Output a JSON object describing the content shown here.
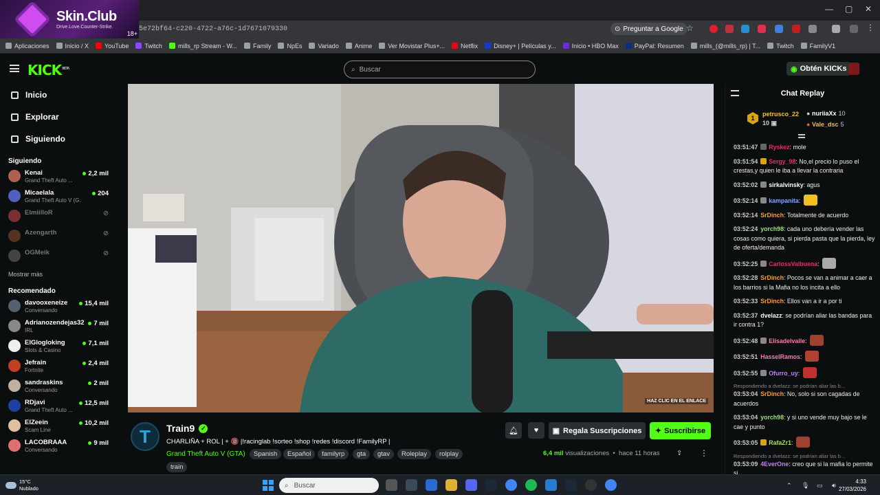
{
  "browser": {
    "url": "5e72bf64-c220-4722-a76c-1d7671079330",
    "ask_google": "Preguntar a Google",
    "ad_brand": "Skin.Club",
    "ad_slogan": "Drive.Love.Counter-Strike.",
    "ad_age": "18+",
    "bookmarks": [
      {
        "label": "Aplicaciones",
        "color": "#9aa0a6"
      },
      {
        "label": "Inicio / X",
        "color": "#9aa0a6"
      },
      {
        "label": "YouTube",
        "color": "#ff0000"
      },
      {
        "label": "Twitch",
        "color": "#9146ff"
      },
      {
        "label": "mills_rp Stream - W...",
        "color": "#53fc18"
      },
      {
        "label": "Family",
        "color": "#9aa0a6"
      },
      {
        "label": "NpEs",
        "color": "#9aa0a6"
      },
      {
        "label": "Variado",
        "color": "#9aa0a6"
      },
      {
        "label": "Anime",
        "color": "#9aa0a6"
      },
      {
        "label": "Ver Movistar Plus+...",
        "color": "#9aa0a6"
      },
      {
        "label": "Netflix",
        "color": "#e50914"
      },
      {
        "label": "Disney+ | Películas y...",
        "color": "#113ccf"
      },
      {
        "label": "Inicio • HBO Max",
        "color": "#6b2bd6"
      },
      {
        "label": "PayPal: Resumen",
        "color": "#003087"
      },
      {
        "label": "mills_(@mills_rp) | T...",
        "color": "#9aa0a6"
      },
      {
        "label": "Twitch",
        "color": "#9aa0a6"
      },
      {
        "label": "FamilyV1",
        "color": "#9aa0a6"
      }
    ]
  },
  "header": {
    "logo": "KICK",
    "logo_badge": "BETA",
    "search_placeholder": "Buscar",
    "kicks_button": "Obtén KICKs"
  },
  "sidebar": {
    "nav": [
      {
        "label": "Inicio",
        "icon": "home-icon"
      },
      {
        "label": "Explorar",
        "icon": "explore-icon"
      },
      {
        "label": "Siguiendo",
        "icon": "heart-icon"
      }
    ],
    "following_title": "Siguiendo",
    "following": [
      {
        "name": "Kenai",
        "game": "Grand Theft Auto ...",
        "viewers": "2,2 mil",
        "live": true,
        "color": "#b06050"
      },
      {
        "name": "Micaelala",
        "game": "Grand Theft Auto V (G...",
        "viewers": "204",
        "live": true,
        "color": "#5060c0"
      },
      {
        "name": "ElmiilloR",
        "game": "",
        "viewers": "",
        "live": false,
        "color": "#7a3030"
      },
      {
        "name": "Azengarth",
        "game": "",
        "viewers": "",
        "live": false,
        "color": "#553322"
      },
      {
        "name": "OGMeik",
        "game": "",
        "viewers": "",
        "live": false,
        "color": "#444"
      }
    ],
    "show_more": "Mostrar más",
    "recommended_title": "Recomendado",
    "recommended": [
      {
        "name": "davooxeneize",
        "game": "Conversando",
        "viewers": "15,4 mil",
        "color": "#556070"
      },
      {
        "name": "Adrianozendejas32",
        "game": "IRL",
        "viewers": "7 mil",
        "color": "#888"
      },
      {
        "name": "ElGlogloking",
        "game": "Slots & Casino",
        "viewers": "7,1 mil",
        "color": "#eee"
      },
      {
        "name": "Jefrain",
        "game": "Fortnite",
        "viewers": "2,4 mil",
        "color": "#c04020"
      },
      {
        "name": "sandraskins",
        "game": "Conversando",
        "viewers": "2 mil",
        "color": "#c0b0a0"
      },
      {
        "name": "RDjavi",
        "game": "Grand Theft Auto ...",
        "viewers": "12,5 mil",
        "color": "#2040a0"
      },
      {
        "name": "ElZeein",
        "game": "Scam Line",
        "viewers": "10,2 mil",
        "color": "#e0c0a0"
      },
      {
        "name": "LACOBRAAA",
        "game": "Conversando",
        "viewers": "9 mil",
        "color": "#e07070"
      }
    ]
  },
  "video": {
    "overlay_text": "HAZ CLIC EN EL ENLACE"
  },
  "stream": {
    "channel": "Train9",
    "title": "CHARLIÑA + ROL | + 🔞 |!racinglab !sorteo !shop !redes !discord !FamilyRP |",
    "category": "Grand Theft Auto V (GTA)",
    "tags": [
      "Spanish",
      "Español",
      "familyrp",
      "gta",
      "gtav",
      "Roleplay",
      "rolplay",
      "train"
    ],
    "gift_button": "Regala Suscripciones",
    "subscribe_button": "Suscribirse",
    "views": "6,4 mil",
    "views_label": "visualizaciones",
    "time_ago": "hace 11 horas"
  },
  "chat": {
    "title": "Chat Replay",
    "gifters": [
      {
        "rank": "1",
        "name": "petrusco_22",
        "count": "10",
        "color": "#f0c040"
      },
      {
        "rank": "",
        "name": "nuriiaXx",
        "count": "10",
        "color": "#fff"
      },
      {
        "rank": "",
        "name": "Vale_dsc",
        "count": "5",
        "color": "#f0c040"
      }
    ],
    "messages": [
      {
        "time": "03:51:47",
        "user": "Ryskez",
        "color": "#e0306a",
        "text": "mole",
        "badge": "#666",
        "emote": "",
        "reply": ""
      },
      {
        "time": "03:51:54",
        "user": "Sergy_98",
        "color": "#e0306a",
        "text": "No,el precio lo puso el crestas,y quien le iba a llevar la contraria",
        "badge": "#d8a414",
        "emote": "",
        "reply": ""
      },
      {
        "time": "03:52:02",
        "user": "sirkalvinsky",
        "color": "#ffffff",
        "text": "agus",
        "badge": "#888",
        "emote": "",
        "reply": ""
      },
      {
        "time": "03:52:14",
        "user": "kampanita",
        "color": "#7fa8ff",
        "text": "",
        "badge": "#888",
        "emote": "#f0c020",
        "reply": ""
      },
      {
        "time": "03:52:14",
        "user": "SrDinch",
        "color": "#ff9b3a",
        "text": "Totalmente de acuerdo",
        "badge": "",
        "emote": "",
        "reply": ""
      },
      {
        "time": "03:52:24",
        "user": "yorch98",
        "color": "#9fe070",
        "text": "cada uno debería vender las cosas como quiera, si pierda pasta que la pierda, ley de oferta/demanda",
        "badge": "",
        "emote": "",
        "reply": ""
      },
      {
        "time": "03:52:25",
        "user": "CarlossValbuena",
        "color": "#e0306a",
        "text": "",
        "badge": "#888",
        "emote": "#aaa",
        "reply": ""
      },
      {
        "time": "03:52:28",
        "user": "SrDinch",
        "color": "#ff9b3a",
        "text": "Pocos se van a animar a caer a los barrios si la Mafia no los incita a ello",
        "badge": "",
        "emote": "",
        "reply": ""
      },
      {
        "time": "03:52:33",
        "user": "SrDinch",
        "color": "#ff9b3a",
        "text": "Ellos van a ir a por ti",
        "badge": "",
        "emote": "",
        "reply": ""
      },
      {
        "time": "03:52:37",
        "user": "dvelazz",
        "color": "#ffffff",
        "text": "se podrían aliar las bandas para ir contra 1?",
        "badge": "",
        "emote": "",
        "reply": ""
      },
      {
        "time": "03:52:48",
        "user": "Elisadelvalle",
        "color": "#ff7ab0",
        "text": "",
        "badge": "#888",
        "emote": "#a04030",
        "reply": ""
      },
      {
        "time": "03:52:51",
        "user": "HasselRamos",
        "color": "#ff7ab0",
        "text": "",
        "badge": "",
        "emote": "#b04030",
        "reply": ""
      },
      {
        "time": "03:52:55",
        "user": "Ofurro_uy",
        "color": "#c080ff",
        "text": "",
        "badge": "#888",
        "emote": "#c03030",
        "reply": ""
      },
      {
        "time": "03:53:04",
        "user": "SrDinch",
        "color": "#ff9b3a",
        "text": "No, solo si son cagadas de acuerdos",
        "badge": "",
        "emote": "",
        "reply": "Respondiendo a dvelazz: se podrían aliar las b..."
      },
      {
        "time": "03:53:04",
        "user": "yorch98",
        "color": "#9fe070",
        "text": "y si uno vende muy bajo se le cae y punto",
        "badge": "",
        "emote": "",
        "reply": ""
      },
      {
        "time": "03:53:05",
        "user": "RafaZr1",
        "color": "#9fe070",
        "text": "",
        "badge": "#d8a414",
        "emote": "#a04030",
        "reply": ""
      },
      {
        "time": "03:53:09",
        "user": "4EverOne",
        "color": "#c080ff",
        "text": "creo que si la mafia lo permite si.",
        "badge": "",
        "emote": "",
        "reply": "Respondiendo a dvelazz: se podrían aliar las b..."
      }
    ]
  },
  "taskbar": {
    "temp": "15°C",
    "weather": "Nublado",
    "search": "Buscar",
    "time": "4:33",
    "date": "27/03/2026"
  }
}
